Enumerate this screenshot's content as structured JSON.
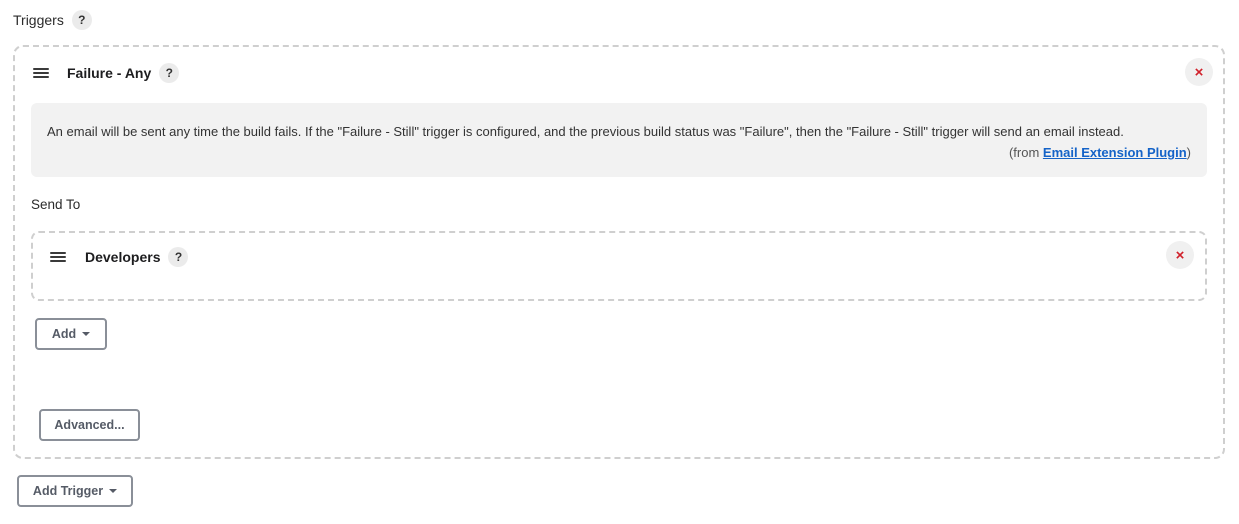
{
  "triggers": {
    "label": "Triggers",
    "help": "?",
    "add_trigger_label": "Add Trigger",
    "items": [
      {
        "title": "Failure - Any",
        "help": "?",
        "close": "×",
        "description": "An email will be sent any time the build fails. If the \"Failure - Still\" trigger is configured, and the previous build status was \"Failure\", then the \"Failure - Still\" trigger will send an email instead.",
        "from_prefix": "(from ",
        "from_link": "Email Extension Plugin",
        "from_suffix": ")",
        "send_to_label": "Send To",
        "recipients": [
          {
            "title": "Developers",
            "help": "?",
            "close": "×"
          }
        ],
        "add_label": "Add",
        "advanced_label": "Advanced..."
      }
    ]
  },
  "colors": {
    "link": "#1463c8",
    "close": "#d0202a",
    "dashed_border": "#cfcfcf",
    "help_box_bg": "#f2f2f2"
  },
  "icons": {
    "drag": "drag-handle-icon",
    "close": "close-icon",
    "dropdown": "caret-down-icon",
    "help": "help-icon"
  }
}
